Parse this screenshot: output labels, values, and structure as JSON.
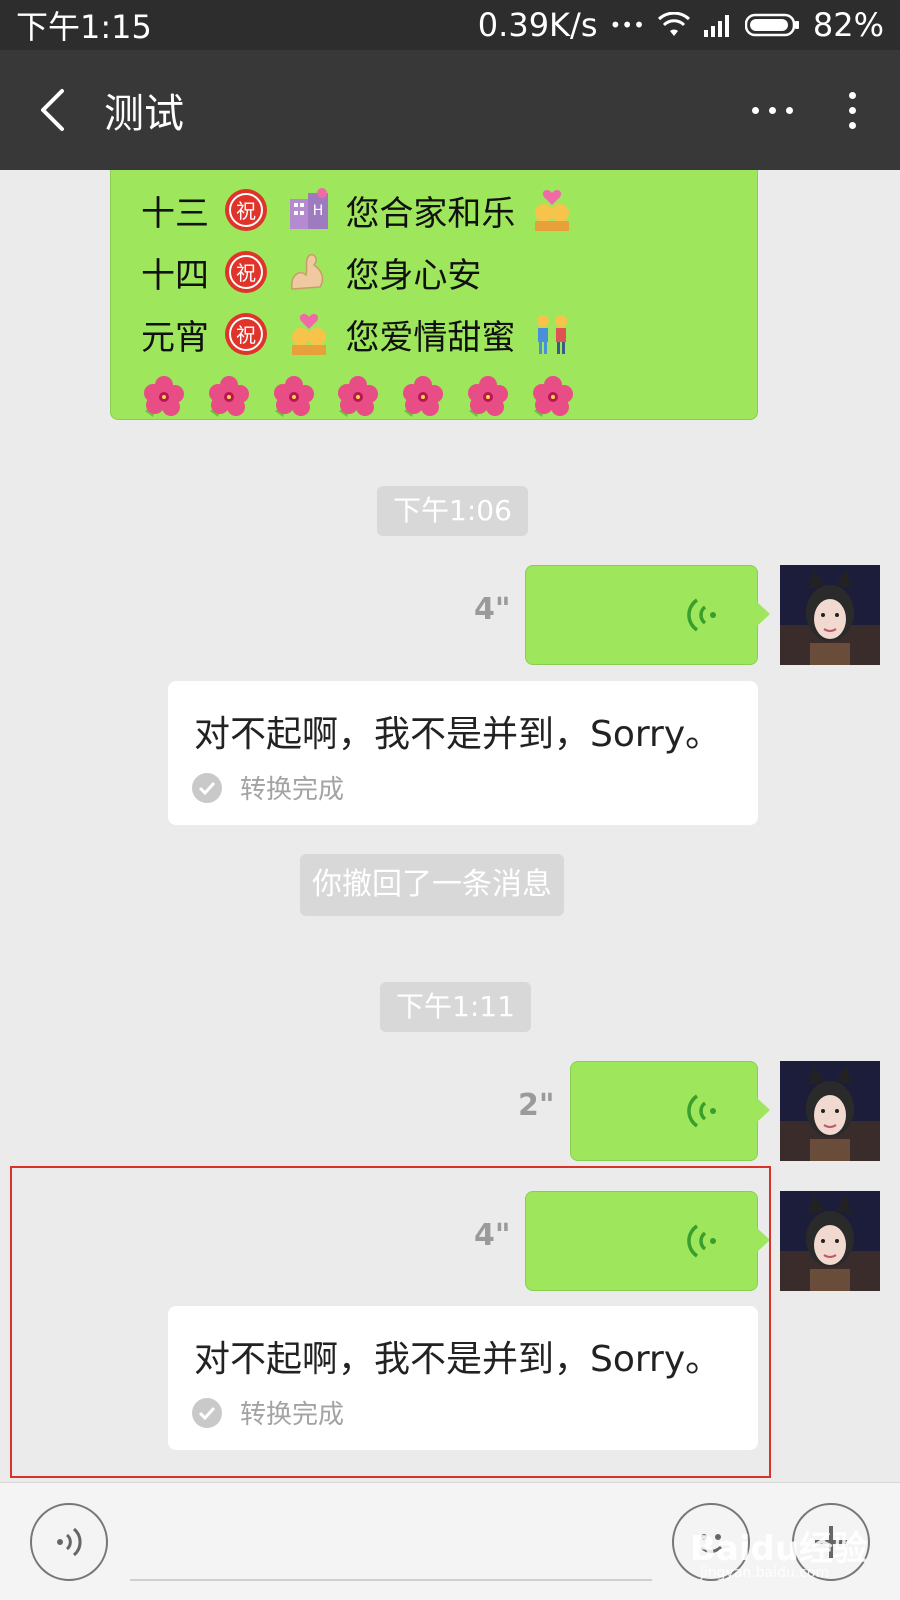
{
  "status_bar": {
    "time": "下午1:15",
    "speed": "0.39K/s",
    "dots": "•••",
    "battery": "82%"
  },
  "header": {
    "title": "测试"
  },
  "top_bubble": {
    "lines": [
      {
        "prefix": "十三",
        "text": "您合家和乐"
      },
      {
        "prefix": "十四",
        "text": "您身心安"
      },
      {
        "prefix": "元宵",
        "text": "您爱情甜蜜"
      }
    ],
    "flower_count": 7
  },
  "timestamps": {
    "first": "下午1:06",
    "second": "下午1:11"
  },
  "system_message": "你撤回了一条消息",
  "voice_messages": [
    {
      "duration": "4\""
    },
    {
      "duration": "2\""
    },
    {
      "duration": "4\""
    }
  ],
  "transcripts": [
    {
      "text": "对不起啊，我不是并到，Sorry。",
      "status": "转换完成"
    },
    {
      "text": "对不起啊，我不是并到，Sorry。",
      "status": "转换完成"
    }
  ],
  "watermark": {
    "main": "Baidu经验",
    "sub": "jingyan.baidu.com"
  },
  "colors": {
    "bubble_green": "#9ee65b",
    "voice_icon": "#3a9e2c",
    "header": "#383838",
    "highlight": "#d9322a"
  },
  "icons": [
    "back-icon",
    "more-dots-icon",
    "menu-icon",
    "voice-wave-icon",
    "check-icon",
    "voice-input-icon",
    "emoji-icon",
    "plus-icon"
  ]
}
